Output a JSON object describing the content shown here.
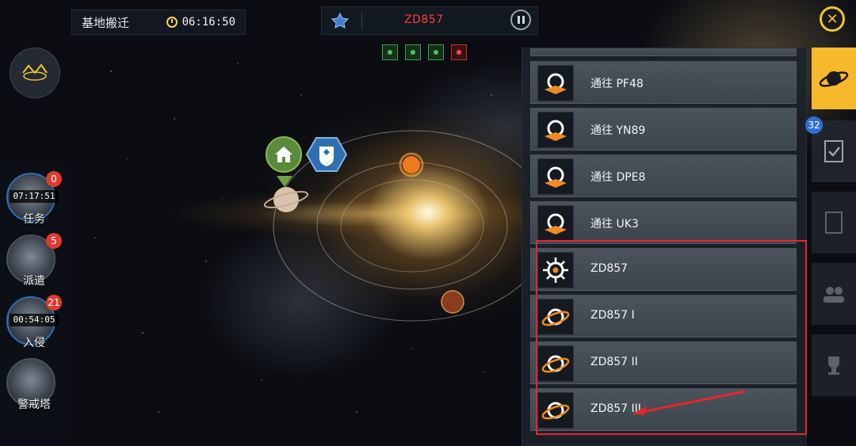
{
  "header": {
    "title": "基地搬迁",
    "clock_time": "06:16:50",
    "system_name": "ZD857",
    "pause_icon": "pause-icon",
    "close_icon": "close-icon"
  },
  "status_indicators": [
    {
      "name": "fleet-status-icon",
      "color": "#3c9b46"
    },
    {
      "name": "sensor-status-icon",
      "color": "#3c9b46"
    },
    {
      "name": "trade-status-icon",
      "color": "#3c9b46"
    },
    {
      "name": "alert-status-icon",
      "color": "#c53030"
    }
  ],
  "sidebar": {
    "items": [
      {
        "label": "任务",
        "badge": "0",
        "timer": "07:17:51"
      },
      {
        "label": "派遣",
        "badge": "5",
        "timer": ""
      },
      {
        "label": "入侵",
        "badge": "21",
        "timer": "00:54:05"
      },
      {
        "label": "警戒塔",
        "badge": "",
        "timer": ""
      }
    ]
  },
  "destinations": {
    "items": [
      {
        "label": "通往 PF48",
        "icon": "warp-gate-icon"
      },
      {
        "label": "通往 YN89",
        "icon": "warp-gate-icon"
      },
      {
        "label": "通往 DPE8",
        "icon": "warp-gate-icon"
      },
      {
        "label": "通往 UK3",
        "icon": "warp-gate-icon"
      },
      {
        "label": "ZD857",
        "icon": "star-icon"
      },
      {
        "label": "ZD857 I",
        "icon": "planet-icon"
      },
      {
        "label": "ZD857 II",
        "icon": "planet-icon"
      },
      {
        "label": "ZD857 III",
        "icon": "planet-icon"
      }
    ]
  },
  "tabs": {
    "badge": "32",
    "items": [
      "planet-tab-icon",
      "tasks-tab-icon",
      "report-tab-icon",
      "crew-tab-icon",
      "trophy-tab-icon"
    ]
  },
  "colors": {
    "accent": "#f7b92c",
    "highlight": "#e5262d",
    "system_name": "#ff3b3b",
    "badge_red": "#e03a2f",
    "badge_blue": "#2f6fd6"
  }
}
